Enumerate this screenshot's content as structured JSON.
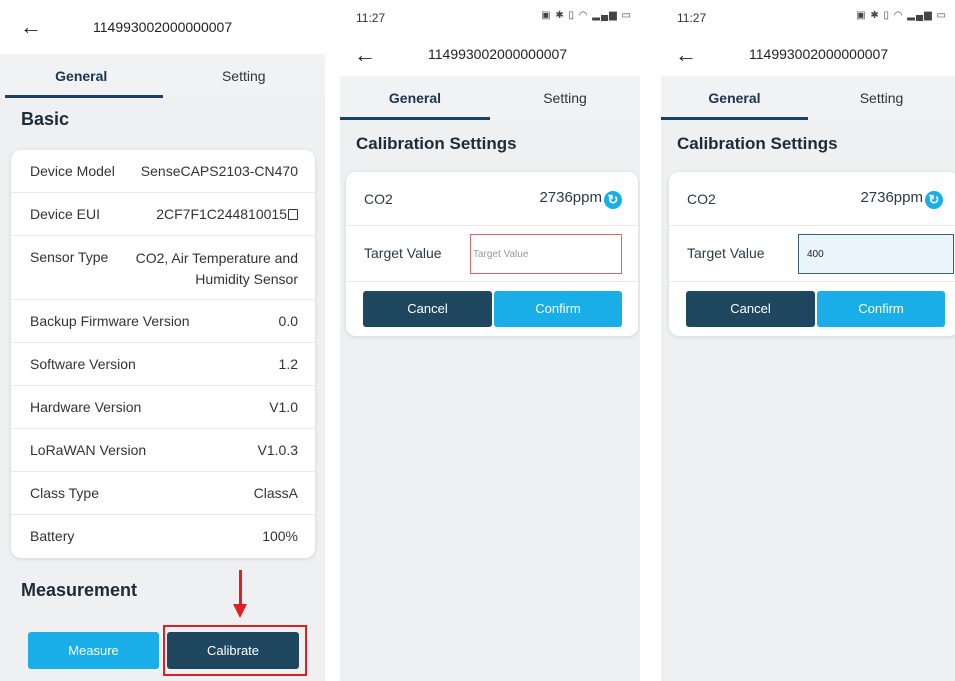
{
  "screen1": {
    "device_id": "114993002000000007",
    "tabs": [
      "General",
      "Setting"
    ],
    "section_basic": "Basic",
    "rows": [
      {
        "key": "Device Model",
        "value": "SenseCAPS2103-CN470"
      },
      {
        "key": "Device EUI",
        "value": "2CF7F1C244810015"
      },
      {
        "key": "Sensor Type",
        "value": "CO2, Air Temperature and Humidity Sensor"
      },
      {
        "key": "Backup Firmware Version",
        "value": "0.0"
      },
      {
        "key": "Software Version",
        "value": "1.2"
      },
      {
        "key": "Hardware Version",
        "value": "V1.0"
      },
      {
        "key": "LoRaWAN Version",
        "value": "V1.0.3"
      },
      {
        "key": "Class Type",
        "value": "ClassA"
      },
      {
        "key": "Battery",
        "value": "100%"
      }
    ],
    "section_measurement": "Measurement",
    "measure_label": "Measure",
    "calibrate_label": "Calibrate"
  },
  "screen2": {
    "time": "11:27",
    "device_id": "114993002000000007",
    "tabs": [
      "General",
      "Setting"
    ],
    "title": "Calibration Settings",
    "co2_label": "CO2",
    "co2_value": "2736ppm",
    "target_label": "Target Value",
    "target_placeholder": "Target Value",
    "cancel_label": "Cancel",
    "confirm_label": "Confirm"
  },
  "screen3": {
    "time": "11:27",
    "device_id": "114993002000000007",
    "tabs": [
      "General",
      "Setting"
    ],
    "title": "Calibration Settings",
    "co2_label": "CO2",
    "co2_value": "2736ppm",
    "target_label": "Target Value",
    "target_value": "400",
    "cancel_label": "Cancel",
    "confirm_label": "Confirm"
  },
  "colors": {
    "accent_blue": "#1aaee8",
    "navy": "#1f4860",
    "tab_underline": "#1b3f66",
    "highlight_red": "#e02020"
  },
  "icons": [
    "back-arrow-icon",
    "copy-icon",
    "refresh-icon",
    "down-arrow-annotation"
  ]
}
